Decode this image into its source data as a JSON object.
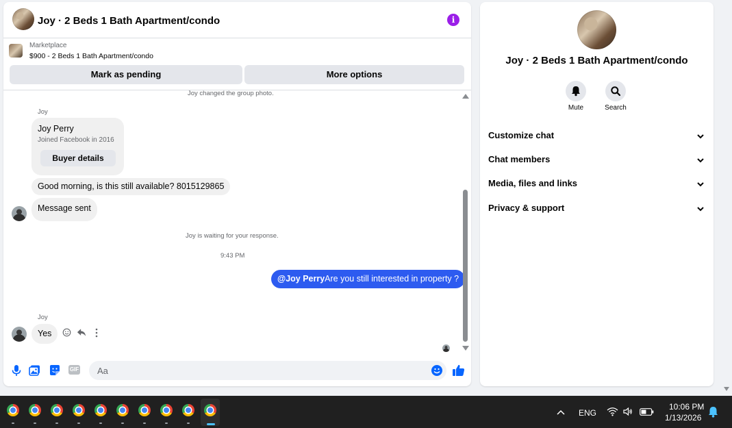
{
  "header": {
    "title": "Joy · 2 Beds 1 Bath Apartment/condo"
  },
  "marketplace": {
    "label": "Marketplace",
    "listing": "$900 - 2 Beds 1 Bath Apartment/condo"
  },
  "actions": {
    "pending": "Mark as pending",
    "more": "More options"
  },
  "messages": {
    "group_photo": "Joy changed the group photo.",
    "sender1": "Joy",
    "profile_name": "Joy Perry",
    "profile_joined": "Joined Facebook in 2016",
    "buyer_details": "Buyer details",
    "msg1": "Good morning, is this still available? 8015129865",
    "msg2": "Message sent",
    "waiting": "Joy is waiting for your response.",
    "timestamp": "9:43 PM",
    "mention": "@Joy Perry",
    "my_msg": "Are you still interested in property ?",
    "sender2": "Joy",
    "msg3": "Yes"
  },
  "composer": {
    "placeholder": "Aa"
  },
  "right_panel": {
    "title": "Joy · 2 Beds 1 Bath Apartment/condo",
    "mute": "Mute",
    "search": "Search",
    "sections": [
      "Customize chat",
      "Chat members",
      "Media, files and links",
      "Privacy & support"
    ]
  },
  "taskbar": {
    "lang": "ENG",
    "time": "10:06 PM",
    "date": "1/13/2026"
  },
  "colors": {
    "accent": "#0866ff",
    "my_bubble": "#2d5bf0",
    "info": "#9b1fe8"
  }
}
